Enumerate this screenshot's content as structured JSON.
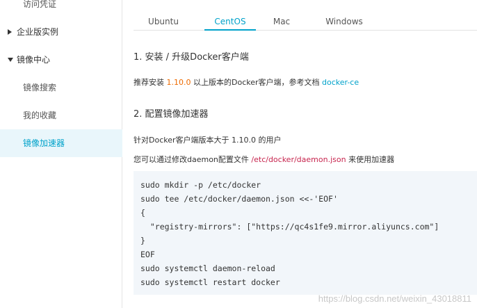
{
  "sidebar": {
    "items": [
      {
        "label": "访问凭证"
      },
      {
        "label": "企业版实例"
      },
      {
        "label": "镜像中心"
      },
      {
        "label": "镜像搜索"
      },
      {
        "label": "我的收藏"
      },
      {
        "label": "镜像加速器"
      }
    ]
  },
  "tabs": [
    {
      "label": "Ubuntu"
    },
    {
      "label": "CentOS"
    },
    {
      "label": "Mac"
    },
    {
      "label": "Windows"
    }
  ],
  "section1": {
    "title": "1. 安装 / 升级Docker客户端",
    "text_pre": "推荐安装 ",
    "version": "1.10.0",
    "text_mid": " 以上版本的Docker客户端，参考文档 ",
    "link": "docker-ce"
  },
  "section2": {
    "title": "2. 配置镜像加速器",
    "line1": "针对Docker客户端版本大于 1.10.0 的用户",
    "line2_pre": "您可以通过修改daemon配置文件 ",
    "path": "/etc/docker/daemon.json",
    "line2_post": " 来使用加速器"
  },
  "code": {
    "lines": [
      "sudo mkdir -p /etc/docker",
      "sudo tee /etc/docker/daemon.json <<-'EOF'",
      "{",
      "  \"registry-mirrors\": [\"https://qc4s1fe9.mirror.aliyuncs.com\"]",
      "}",
      "EOF",
      "sudo systemctl daemon-reload",
      "sudo systemctl restart docker"
    ]
  },
  "watermark": "https://blog.csdn.net/weixin_43018811",
  "colors": {
    "accent": "#00a2ca",
    "version": "#ee6a00",
    "path": "#c7254e",
    "active_bg": "#e9f6fb",
    "code_bg": "#f2f6fa"
  }
}
